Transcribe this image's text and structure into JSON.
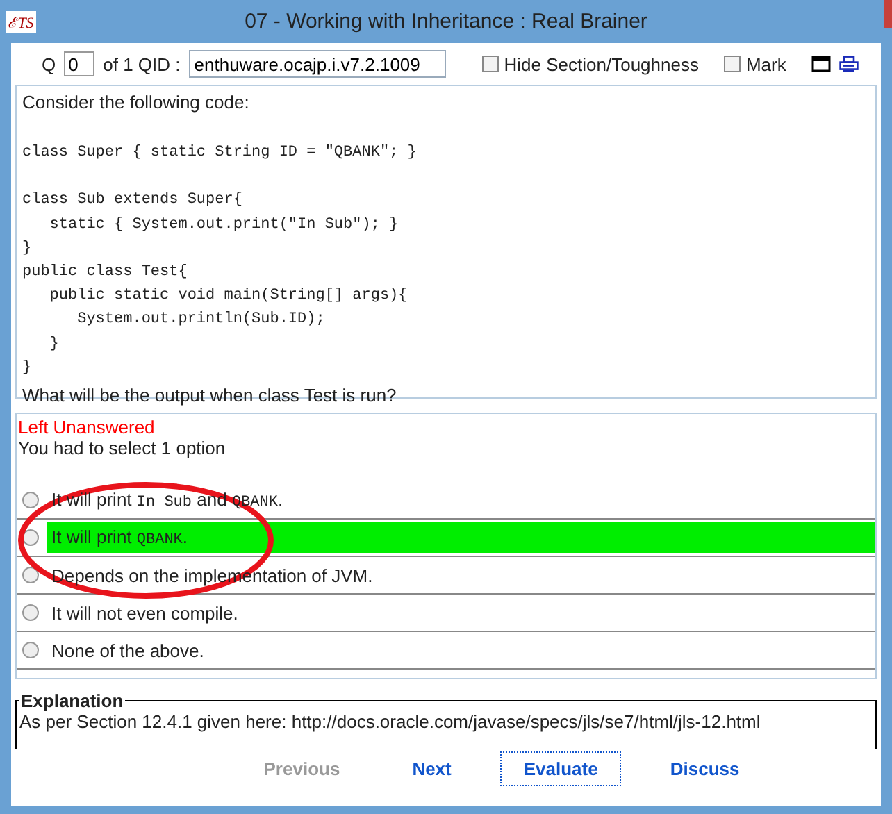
{
  "window": {
    "logo": "ℰTS",
    "title": "07 - Working with Inheritance  :  Real Brainer"
  },
  "toolbar": {
    "q_label": "Q",
    "q_number": "0",
    "of_label": "of 1 QID :",
    "qid": "enthuware.ocajp.i.v7.2.1009",
    "checkboxes": [
      {
        "label": "Hide Section/Toughness",
        "checked": false
      },
      {
        "label": "Mark",
        "checked": false
      }
    ]
  },
  "question": {
    "intro": "Consider the following code:",
    "code": "class Super { static String ID = \"QBANK\"; }\n\nclass Sub extends Super{\n   static { System.out.print(\"In Sub\"); }\n}\npublic class Test{\n   public static void main(String[] args){\n      System.out.println(Sub.ID);\n   }\n}",
    "prompt": "What will be the output when class Test is run?"
  },
  "answer": {
    "status": "Left Unanswered",
    "instruction": "You had to select 1 option",
    "options": [
      {
        "selected": false,
        "correct": false,
        "segments": [
          {
            "kind": "text",
            "text": "It will print "
          },
          {
            "kind": "code",
            "text": "In Sub"
          },
          {
            "kind": "text",
            "text": " and "
          },
          {
            "kind": "code",
            "text": "QBANK"
          },
          {
            "kind": "text",
            "text": "."
          }
        ]
      },
      {
        "selected": false,
        "correct": true,
        "segments": [
          {
            "kind": "text",
            "text": "It will print "
          },
          {
            "kind": "code",
            "text": "QBANK"
          },
          {
            "kind": "text",
            "text": "."
          }
        ]
      },
      {
        "selected": false,
        "correct": false,
        "segments": [
          {
            "kind": "text",
            "text": "Depends on the implementation of JVM."
          }
        ]
      },
      {
        "selected": false,
        "correct": false,
        "segments": [
          {
            "kind": "text",
            "text": "It will not even compile."
          }
        ]
      },
      {
        "selected": false,
        "correct": false,
        "segments": [
          {
            "kind": "text",
            "text": "None of the above."
          }
        ]
      }
    ]
  },
  "explanation": {
    "heading": "Explanation",
    "text": "As per Section 12.4.1 given here: http://docs.oracle.com/javase/specs/jls/se7/html/jls-12.html"
  },
  "buttons": [
    {
      "label": "Previous",
      "disabled": true,
      "focused": false
    },
    {
      "label": "Next",
      "disabled": false,
      "focused": false
    },
    {
      "label": "Evaluate",
      "disabled": false,
      "focused": true
    },
    {
      "label": "Discuss",
      "disabled": false,
      "focused": false
    }
  ]
}
